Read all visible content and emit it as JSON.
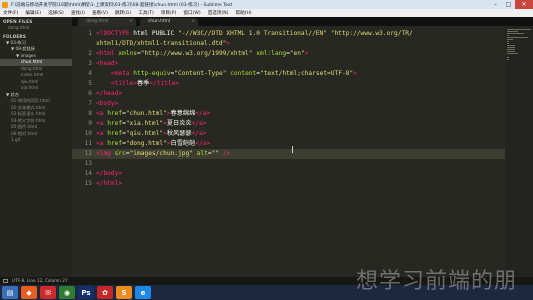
{
  "window": {
    "title": "F:\\前端与移动开发学院\\16期\\html课程\\1-上课资料\\03-练习\\08-超链接\\chun.html (03-练习) - Sublime Text"
  },
  "menu": [
    "文件(F)",
    "编辑(E)",
    "选择(S)",
    "查找(I)",
    "查看(V)",
    "跳转(G)",
    "工具(T)",
    "项目(P)",
    "窗口(W)",
    "首选项(N)",
    "帮助(H)"
  ],
  "sidebar": {
    "open_files_header": "OPEN FILES",
    "open_files": [
      "dong.html"
    ],
    "folders_header": "FOLDERS",
    "items": [
      {
        "label": "▼ 03-练习",
        "type": "folder",
        "indent": 1
      },
      {
        "label": "▼ 08-超链接",
        "type": "folder",
        "indent": 2
      },
      {
        "label": "▼ images",
        "type": "folder",
        "indent": 3
      },
      {
        "label": "chun.html",
        "type": "file",
        "indent": 4,
        "selected": true
      },
      {
        "label": "dong.html",
        "type": "file",
        "indent": 4
      },
      {
        "label": "index.html",
        "type": "file",
        "indent": 4
      },
      {
        "label": "qiu.html",
        "type": "file",
        "indent": 4
      },
      {
        "label": "xia.html",
        "type": "file",
        "indent": 4
      },
      {
        "label": "▼ 综合",
        "type": "folder",
        "indent": 1
      },
      {
        "label": "01-常用的网页.html",
        "type": "file",
        "indent": 2
      },
      {
        "label": "02-文本格式.html",
        "type": "file",
        "indent": 2
      },
      {
        "label": "03-标签语义.html",
        "type": "file",
        "indent": 2
      },
      {
        "label": "04-转义字符.html",
        "type": "file",
        "indent": 2
      },
      {
        "label": "05-图片.html",
        "type": "file",
        "indent": 2
      },
      {
        "label": "06-相对.html",
        "type": "file",
        "indent": 2
      },
      {
        "label": "1.gif",
        "type": "file",
        "indent": 2
      }
    ]
  },
  "tabs": [
    {
      "label": "dong.html",
      "active": false
    },
    {
      "label": "chun.html",
      "active": true
    }
  ],
  "editor": {
    "line_numbers": [
      "1",
      "",
      "2",
      "3",
      "4",
      "5",
      "6",
      "7",
      "8",
      "9",
      "10",
      "11",
      "12",
      "13",
      "14",
      "15"
    ],
    "current_line": 12,
    "lines": [
      [
        [
          "t-doctype",
          "<!DOCTYPE"
        ],
        [
          "t-text",
          " html PUBLIC "
        ],
        [
          "t-str",
          "\"-//W3C//DTD XHTML 1.0 Transitional//EN\""
        ],
        [
          "t-text",
          " "
        ],
        [
          "t-str",
          "\"http://www.w3.org/TR/"
        ]
      ],
      [
        [
          "t-str",
          "xhtml1/DTD/xhtml1-transitional.dtd\""
        ],
        [
          "t-tag",
          ">"
        ]
      ],
      [
        [
          "t-tag",
          "<html"
        ],
        [
          "t-text",
          " "
        ],
        [
          "t-attr",
          "xmlns"
        ],
        [
          "t-text",
          "="
        ],
        [
          "t-str",
          "\"http://www.w3.org/1999/xhtml\""
        ],
        [
          "t-text",
          " "
        ],
        [
          "t-attr",
          "xml:lang"
        ],
        [
          "t-text",
          "="
        ],
        [
          "t-str",
          "\"en\""
        ],
        [
          "t-tag",
          ">"
        ]
      ],
      [
        [
          "t-tag",
          "<head>"
        ]
      ],
      [
        [
          "t-text",
          "    "
        ],
        [
          "t-tag",
          "<meta"
        ],
        [
          "t-text",
          " "
        ],
        [
          "t-attr",
          "http-equiv"
        ],
        [
          "t-text",
          "="
        ],
        [
          "t-str",
          "\"Content-Type\""
        ],
        [
          "t-text",
          " "
        ],
        [
          "t-attr",
          "content"
        ],
        [
          "t-text",
          "="
        ],
        [
          "t-str",
          "\"text/html;charset=UTF-8\""
        ],
        [
          "t-tag",
          ">"
        ]
      ],
      [
        [
          "t-text",
          "    "
        ],
        [
          "t-tag",
          "<title>"
        ],
        [
          "t-text",
          "春季"
        ],
        [
          "t-tag",
          "</title>"
        ]
      ],
      [
        [
          "t-tag",
          "</head>"
        ]
      ],
      [
        [
          "t-tag",
          "<body>"
        ]
      ],
      [
        [
          "t-tag",
          "<a"
        ],
        [
          "t-text",
          " "
        ],
        [
          "t-attr",
          "href"
        ],
        [
          "t-text",
          "="
        ],
        [
          "t-str",
          "\"chun.html\""
        ],
        [
          "t-tag",
          ">"
        ],
        [
          "t-text",
          "春意绵绵"
        ],
        [
          "t-tag",
          "</a>"
        ]
      ],
      [
        [
          "t-tag",
          "<a"
        ],
        [
          "t-text",
          " "
        ],
        [
          "t-attr",
          "href"
        ],
        [
          "t-text",
          "="
        ],
        [
          "t-str",
          "\"xia.html\""
        ],
        [
          "t-tag",
          ">"
        ],
        [
          "t-text",
          "夏日炎炎"
        ],
        [
          "t-tag",
          "</a>"
        ]
      ],
      [
        [
          "t-tag",
          "<a"
        ],
        [
          "t-text",
          " "
        ],
        [
          "t-attr",
          "href"
        ],
        [
          "t-text",
          "="
        ],
        [
          "t-str",
          "\"qiu.html\""
        ],
        [
          "t-tag",
          ">"
        ],
        [
          "t-text",
          "秋风瑟瑟"
        ],
        [
          "t-tag",
          "</a>"
        ]
      ],
      [
        [
          "t-tag",
          "<a"
        ],
        [
          "t-text",
          " "
        ],
        [
          "t-attr",
          "href"
        ],
        [
          "t-text",
          "="
        ],
        [
          "t-str",
          "\"dong.html\""
        ],
        [
          "t-tag",
          ">"
        ],
        [
          "t-text",
          "白雪皑皑"
        ],
        [
          "t-tag",
          "</a>"
        ]
      ],
      [
        [
          "t-tag",
          "<img"
        ],
        [
          "t-text",
          " "
        ],
        [
          "t-attr",
          "src"
        ],
        [
          "t-text",
          "="
        ],
        [
          "t-str",
          "\"images/chun.jpg\""
        ],
        [
          "t-text",
          " "
        ],
        [
          "t-attr",
          "alt"
        ],
        [
          "t-text",
          "="
        ],
        [
          "t-str",
          "\"\""
        ],
        [
          "t-text",
          " "
        ],
        [
          "t-tag",
          "/>"
        ]
      ],
      [],
      [
        [
          "t-tag",
          "</body>"
        ]
      ],
      [
        [
          "t-tag",
          "</html>"
        ]
      ]
    ]
  },
  "status": {
    "text": "UTF-8, Line 12, Column 27"
  },
  "taskbar": {
    "icons": [
      {
        "name": "file-manager-icon",
        "color": "#3b6fb5",
        "glyph": "▤"
      },
      {
        "name": "app-shield-icon",
        "color": "#e85d1e",
        "glyph": "◆"
      },
      {
        "name": "mail-icon",
        "color": "#cc2b2b",
        "glyph": "✉"
      },
      {
        "name": "chrome-icon",
        "color": "#2e7d32",
        "glyph": "◉"
      },
      {
        "name": "photoshop-icon",
        "color": "#15306b",
        "glyph": "Ps"
      },
      {
        "name": "paint-icon",
        "color": "#c62828",
        "glyph": "✿"
      },
      {
        "name": "sublime-icon",
        "color": "#ef8a1c",
        "glyph": "S"
      },
      {
        "name": "ie-icon",
        "color": "#1e88e5",
        "glyph": "e"
      }
    ]
  },
  "watermark": "想学习前端的朋"
}
